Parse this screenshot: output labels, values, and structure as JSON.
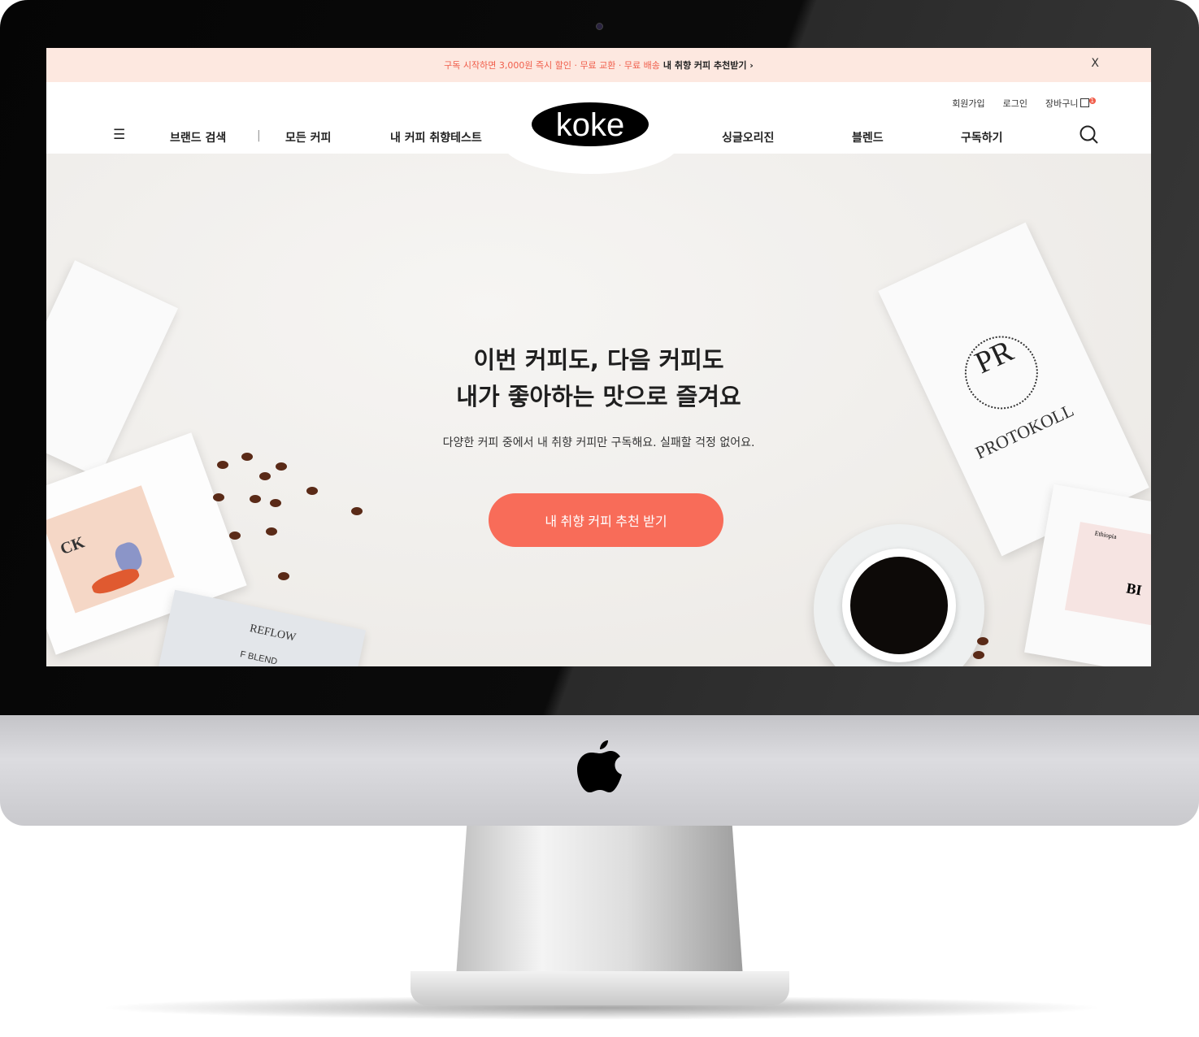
{
  "promo": {
    "text": "구독 시작하면 3,000원 즉시 할인 · 무료 교환 · 무료 배송",
    "link": "내 취향 커피 추천받기 ›",
    "close": "X"
  },
  "utility": {
    "signup": "회원가입",
    "login": "로그인",
    "cart": "장바구니",
    "cart_count": "1"
  },
  "nav": {
    "brand_search": "브랜드 검색",
    "separator": "|",
    "all_coffee": "모든 커피",
    "taste_test": "내 커피 취향테스트",
    "single_origin": "싱글오리진",
    "blend": "블렌드",
    "subscribe": "구독하기"
  },
  "logo": "koke",
  "hero": {
    "line1": "이번 커피도, 다음 커피도",
    "line2": "내가 좋아하는 맛으로 즐겨요",
    "subtitle": "다양한 커피 중에서 내 취향 커피만 구독해요. 실패할 걱정 없어요.",
    "cta": "내 취향 커피 추천 받기"
  },
  "products": {
    "p1": "PROTOKOLL",
    "p1_mark": "PR",
    "p2": "REFLOW",
    "p3": "F BLEND",
    "p4": "CK",
    "p5": "Ethiopia",
    "p6": "BI"
  },
  "colors": {
    "accent": "#f86c59",
    "promo_bg": "#fde8e0"
  }
}
